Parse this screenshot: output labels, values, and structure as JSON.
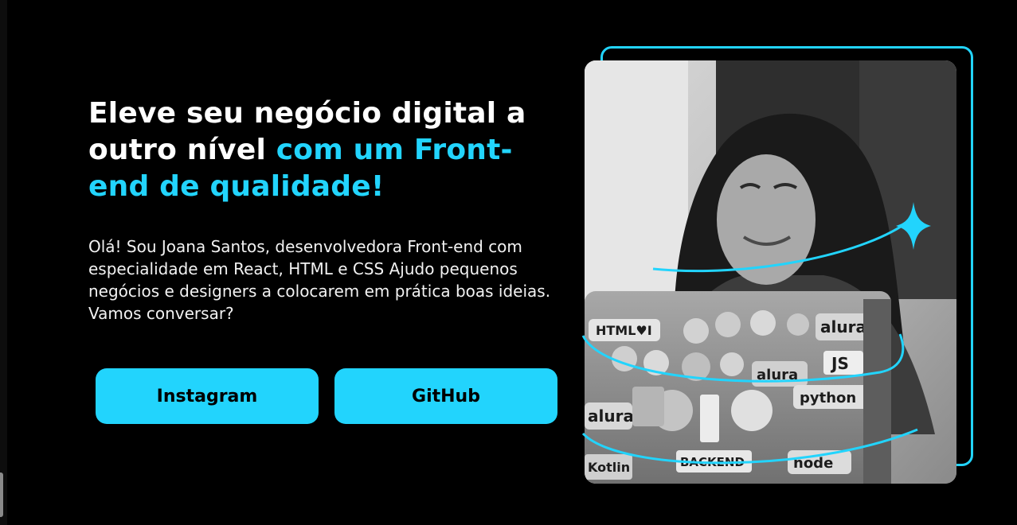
{
  "hero": {
    "title_part1": "Eleve seu negócio digital a outro nível ",
    "title_part2": "com um Front-end de qualidade!",
    "bio": "Olá! Sou Joana Santos, desenvolvedora Front-end com especialidade em React, HTML e CSS Ajudo pequenos negócios e designers a colocarem em prática boas ideias. Vamos conversar?"
  },
  "buttons": {
    "instagram": "Instagram",
    "github": "GitHub"
  },
  "colors": {
    "background": "#000000",
    "accent": "#22d4fd",
    "text": "#ffffff"
  },
  "photo": {
    "stickers": [
      "HTML♥I",
      "alura",
      "JS",
      "alura",
      "python",
      "alura",
      "BACKEND",
      "Kotlin",
      "node"
    ]
  }
}
